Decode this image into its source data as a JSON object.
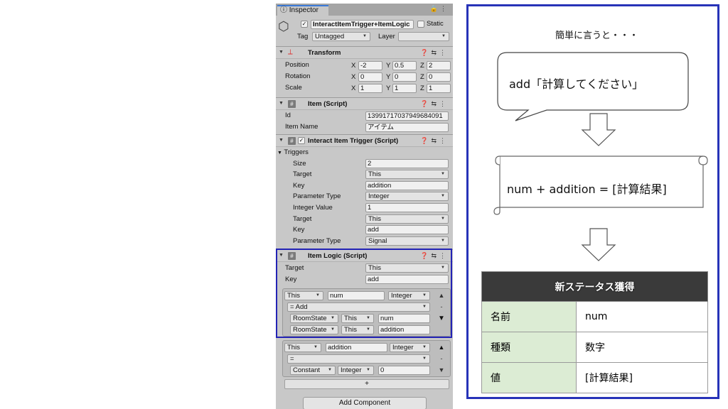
{
  "inspector": {
    "tab": "Inspector",
    "object": {
      "name": "InteractItemTrigger+ItemLogic",
      "static_label": "Static",
      "tag_label": "Tag",
      "tag_value": "Untagged",
      "layer_label": "Layer",
      "layer_value": ""
    },
    "transform": {
      "title": "Transform",
      "position": {
        "label": "Position",
        "x": "-2",
        "y": "0.5",
        "z": "2"
      },
      "rotation": {
        "label": "Rotation",
        "x": "0",
        "y": "0",
        "z": "0"
      },
      "scale": {
        "label": "Scale",
        "x": "1",
        "y": "1",
        "z": "1"
      },
      "axis_x": "X",
      "axis_y": "Y",
      "axis_z": "Z"
    },
    "item_script": {
      "title": "Item (Script)",
      "id_label": "Id",
      "id_value": "13991717037949684091",
      "name_label": "Item Name",
      "name_value": "アイテム"
    },
    "trigger": {
      "title": "Interact Item Trigger (Script)",
      "triggers_label": "Triggers",
      "size_label": "Size",
      "size_value": "2",
      "target_label": "Target",
      "target_value": "This",
      "key_label": "Key",
      "key_value": "addition",
      "ptype_label": "Parameter Type",
      "ptype_value": "Integer",
      "ivalue_label": "Integer Value",
      "ivalue_value": "1",
      "target2_label": "Target",
      "target2_value": "This",
      "key2_label": "Key",
      "key2_value": "add",
      "ptype2_label": "Parameter Type",
      "ptype2_value": "Signal"
    },
    "logic": {
      "title": "Item Logic (Script)",
      "target_label": "Target",
      "target_value": "This",
      "key_label": "Key",
      "key_value": "add",
      "row1": {
        "a": "This",
        "b": "num",
        "c": "Integer"
      },
      "op1": "= Add",
      "row1b": {
        "a": "RoomState",
        "b": "This",
        "c": "num"
      },
      "row1c": {
        "a": "RoomState",
        "b": "This",
        "c": "addition"
      },
      "row2": {
        "a": "This",
        "b": "addition",
        "c": "Integer"
      },
      "op2": "=",
      "row2b": {
        "a": "Constant",
        "b": "Integer",
        "c": "0"
      },
      "plus": "+",
      "minus": "-"
    },
    "add_component": "Add Component"
  },
  "explain": {
    "heading": "簡単に言うと・・・",
    "bubble": "add「計算してください」",
    "scroll": "num + addition = [計算結果]",
    "table": {
      "header": "新ステータス獲得",
      "rows": [
        {
          "k": "名前",
          "v": "num"
        },
        {
          "k": "種類",
          "v": "数字"
        },
        {
          "k": "値",
          "v": "[計算結果]"
        }
      ]
    }
  }
}
